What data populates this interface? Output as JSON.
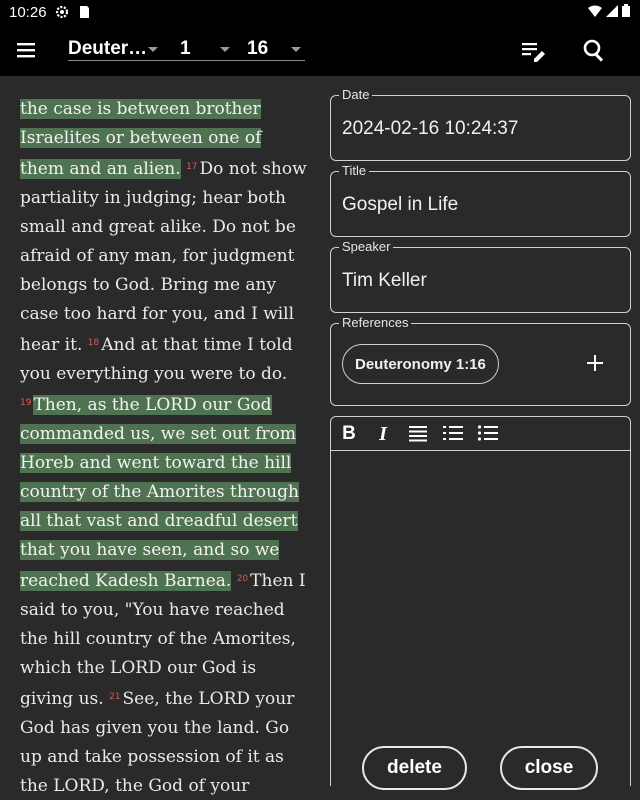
{
  "status_bar": {
    "time": "10:26"
  },
  "app_bar": {
    "book": "Deuter…",
    "chapter": "1",
    "verse": "16"
  },
  "scripture": [
    {
      "text": "the case is between brother Israelites or between one of them and an alien.",
      "hl": true
    },
    {
      "verse": "17"
    },
    {
      "text": "Do not show partiality in judging; hear both small and great alike. Do not be afraid of any man, for judgment belongs to God. Bring me any case too hard for you, and I will hear it. "
    },
    {
      "verse": "18"
    },
    {
      "text": "And at that time I told you everything you were to do. "
    },
    {
      "verse": "19"
    },
    {
      "text": "Then, as the LORD our God commanded us, we set out from Horeb and went toward the hill country of the Amorites through all that vast and dreadful desert that you have seen, and so we reached Kadesh Barnea.",
      "hl": true
    },
    {
      "verse": "20"
    },
    {
      "text": "Then I said to you, \"You have reached the hill country of the Amorites, which the LORD our God is giving us. "
    },
    {
      "verse": "21"
    },
    {
      "text": "See, the LORD your God has given you the land. Go up and take possession of it as the LORD, the God of your fathers,"
    }
  ],
  "form": {
    "date_label": "Date",
    "date_value": "2024-02-16 10:24:37",
    "title_label": "Title",
    "title_value": "Gospel in Life",
    "speaker_label": "Speaker",
    "speaker_value": "Tim Keller",
    "references_label": "References",
    "reference_chip": "Deuteronomy 1:16"
  },
  "editor_toolbar": {
    "bold": "B",
    "italic": "I"
  },
  "buttons": {
    "delete": "delete",
    "close": "close"
  }
}
